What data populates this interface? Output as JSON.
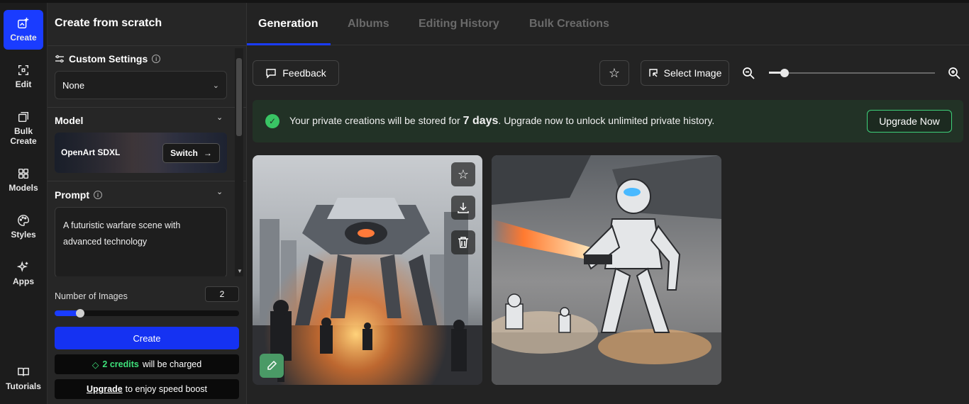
{
  "rail": {
    "create": "Create",
    "edit": "Edit",
    "bulk_create": "Bulk Create",
    "models": "Models",
    "styles": "Styles",
    "apps": "Apps",
    "tutorials": "Tutorials"
  },
  "panel": {
    "title": "Create from scratch",
    "custom_settings": "Custom Settings",
    "custom_settings_value": "None",
    "model_heading": "Model",
    "model_name": "OpenArt SDXL",
    "switch_label": "Switch",
    "prompt_heading": "Prompt",
    "prompt_text": "A futuristic warfare scene with advanced technology",
    "num_images_label": "Number of Images",
    "num_images_value": "2",
    "num_images_level": 0.14,
    "create_label": "Create",
    "credits_amount": "2 credits",
    "credits_suffix": "will be charged",
    "upgrade_link": "Upgrade",
    "upgrade_suffix": "to enjoy speed boost"
  },
  "tabs": [
    "Generation",
    "Albums",
    "Editing History",
    "Bulk Creations"
  ],
  "toolbar": {
    "feedback": "Feedback",
    "select_image": "Select Image"
  },
  "banner": {
    "prefix": "Your private creations will be stored for",
    "days": "7 days",
    "suffix": ". Upgrade now to unlock unlimited private history.",
    "upgrade_button": "Upgrade Now"
  },
  "colors": {
    "accent": "#1a3cff",
    "success": "#39c564"
  }
}
